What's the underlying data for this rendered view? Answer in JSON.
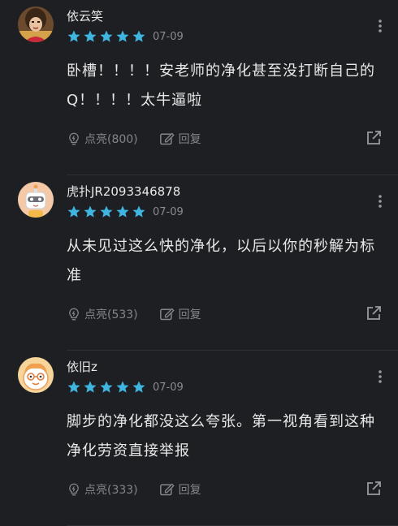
{
  "colors": {
    "background": "#1e1f22",
    "star": "#3fb6e0",
    "muted_text": "#85868a"
  },
  "comments": [
    {
      "username": "依云笑",
      "stars": 5,
      "date": "07-09",
      "content": "卧槽！！！！安老师的净化甚至没打断自己的Q！！！！太牛逼啦",
      "like_label": "点亮(800)",
      "reply_label": "回复",
      "avatar_icon": "portrait-photo-avatar"
    },
    {
      "username": "虎扑JR2093346878",
      "stars": 5,
      "date": "07-09",
      "content": "从未见过这么快的净化，以后以你的秒解为标准",
      "like_label": "点亮(533)",
      "reply_label": "回复",
      "avatar_icon": "robot-avatar"
    },
    {
      "username": "依旧z",
      "stars": 5,
      "date": "07-09",
      "content": "脚步的净化都没这么夸张。第一视角看到这种净化劳资直接举报",
      "like_label": "点亮(333)",
      "reply_label": "回复",
      "avatar_icon": "cartoon-face-avatar"
    }
  ]
}
